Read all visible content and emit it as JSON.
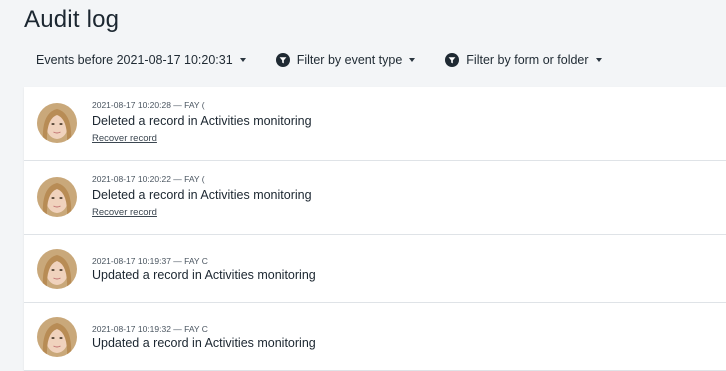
{
  "page": {
    "title": "Audit log"
  },
  "toolbar": {
    "date_filter_label": "Events before 2021-08-17 10:20:31",
    "event_type_label": "Filter by event type",
    "form_folder_label": "Filter by form or folder"
  },
  "entries": [
    {
      "meta": "2021-08-17 10:20:28 — FAY (",
      "action": "Deleted a record in Activities monitoring",
      "link": "Recover record"
    },
    {
      "meta": "2021-08-17 10:20:22 — FAY (",
      "action": "Deleted a record in Activities monitoring",
      "link": "Recover record"
    },
    {
      "meta": "2021-08-17 10:19:37 — FAY C",
      "action": "Updated a record in Activities monitoring"
    },
    {
      "meta": "2021-08-17 10:19:32 — FAY C",
      "action": "Updated a record in Activities monitoring"
    }
  ],
  "icons": {
    "filter": "filter-funnel-icon",
    "caret": "caret-down-icon",
    "avatar": "user-avatar"
  },
  "colors": {
    "background": "#f3f5f7",
    "card": "#ffffff",
    "divider": "#dfe3e7",
    "text": "#1f2a33"
  }
}
